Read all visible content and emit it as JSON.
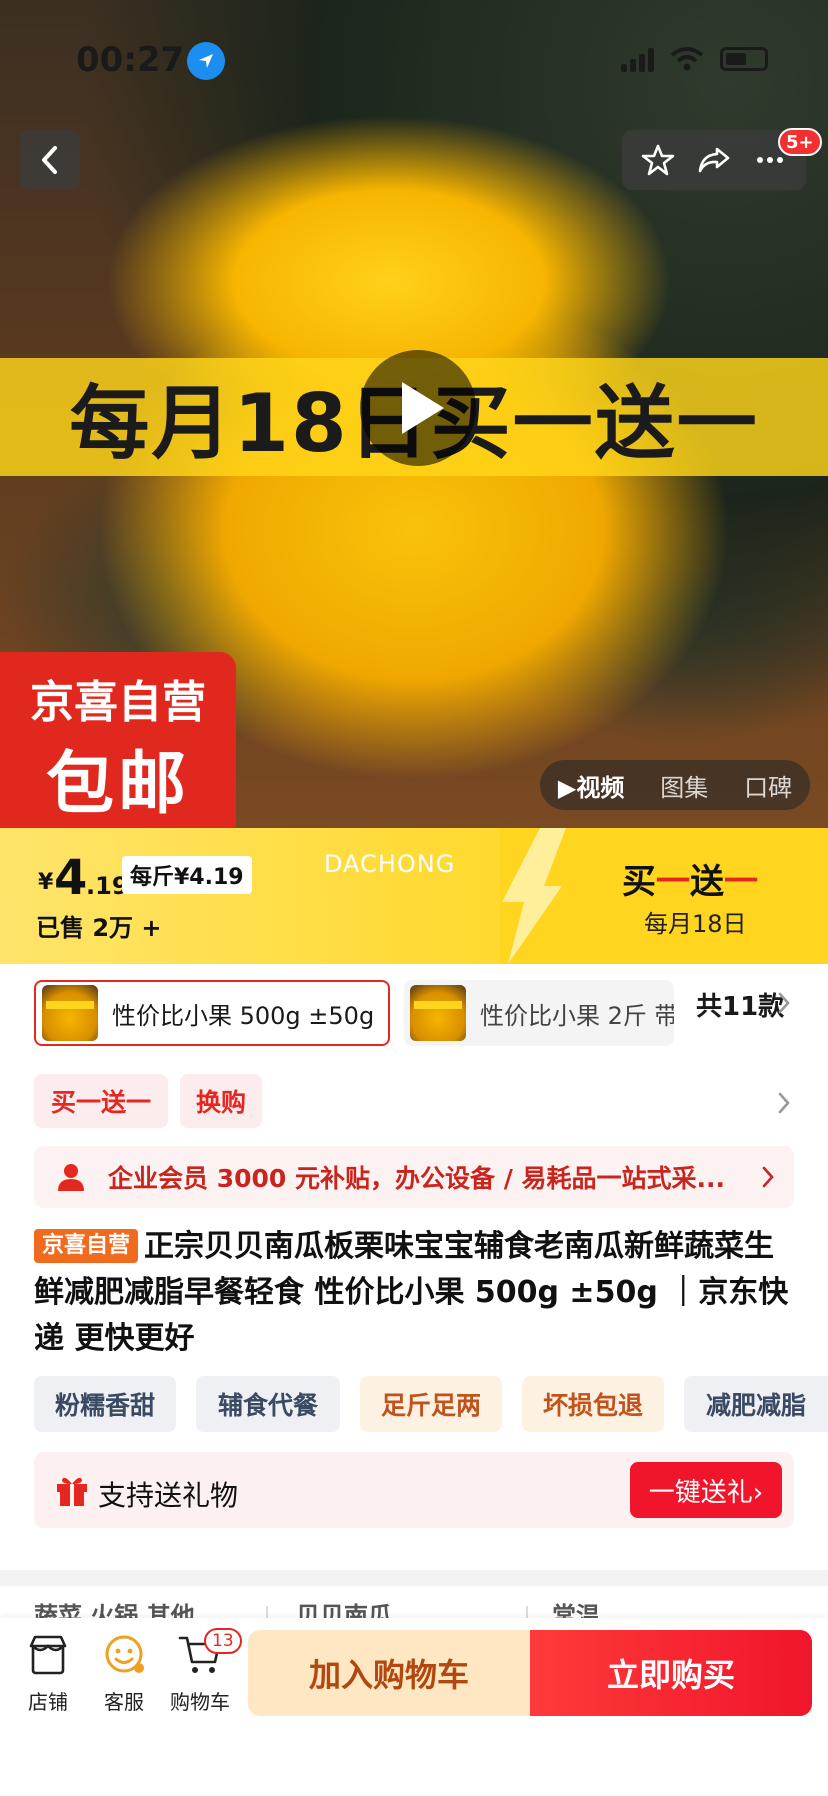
{
  "status_bar": {
    "time": "00:27"
  },
  "hero": {
    "promo_text": "每月18日买一送一",
    "notify_badge": "5+"
  },
  "stamp": {
    "top": "京喜自营",
    "bottom": "包邮"
  },
  "media_tabs": [
    "▶视频",
    "图集",
    "口碑"
  ],
  "price": {
    "currency": "¥",
    "integer": "4",
    "decimal": ".19",
    "unit_price": "每斤¥4.19",
    "sold": "已售 2万 +",
    "watermark": "DACHONG",
    "promo_title_a": "买",
    "promo_title_b": "一",
    "promo_title_c": "送",
    "promo_title_d": "一",
    "promo_sub": "每月18日"
  },
  "variants": {
    "selected": "性价比小果 500g ±50g",
    "other": "性价比小果 2斤 带",
    "count": "共11款"
  },
  "promo_tags": [
    "买一送一",
    "换购"
  ],
  "enterprise": {
    "text": "企业会员 3000 元补贴，办公设备 / 易耗品一站式采..."
  },
  "title": {
    "tag": "京喜自营",
    "text": "正宗贝贝南瓜板栗味宝宝辅食老南瓜新鲜蔬菜生鲜减肥减脂早餐轻食 性价比小果 500g ±50g ｜京东快递 更快更好"
  },
  "feature_tags": [
    "粉糯香甜",
    "辅食代餐",
    "足斤足两",
    "坏损包退",
    "减肥减脂"
  ],
  "gift": {
    "text": "支持送礼物",
    "button": "一键送礼›"
  },
  "peek": [
    "蔬菜 火锅 其他",
    "贝贝南瓜",
    "常温"
  ],
  "bottom_nav": {
    "store": "店铺",
    "service": "客服",
    "cart": "购物车",
    "cart_count": "13",
    "add_to_cart": "加入购物车",
    "buy_now": "立即购买"
  },
  "colors": {
    "accent_red": "#e4281f",
    "banner_yellow": "#ffd92e",
    "buy_red": "#f0152b"
  }
}
